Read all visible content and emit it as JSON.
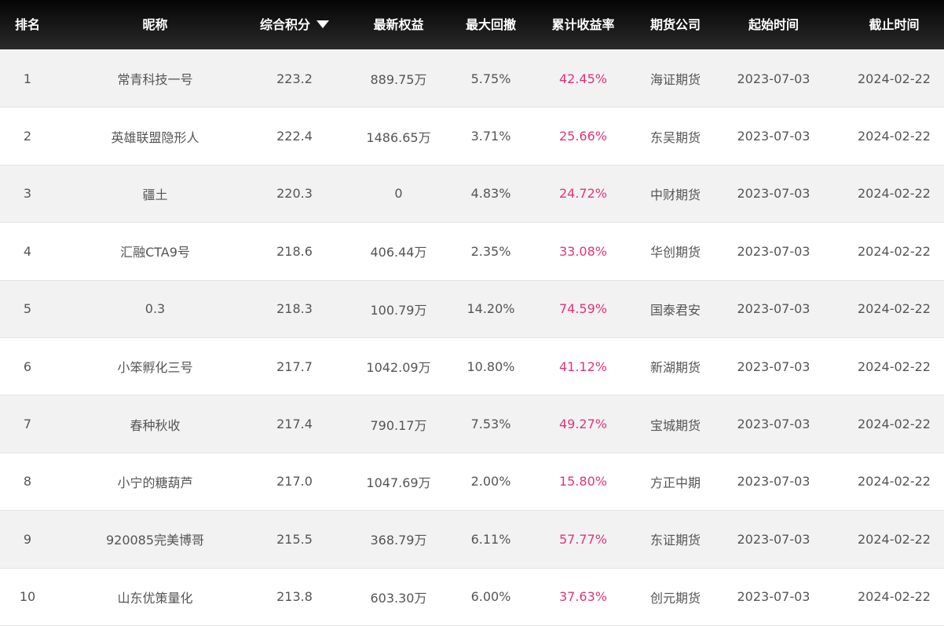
{
  "colors": {
    "header_bg": "#1a1a1a",
    "header_text": "#ffffff",
    "row_alt_bg": "#f2f2f2",
    "text": "#555555",
    "return_rate": "#e0357a"
  },
  "header": {
    "rank": "排名",
    "nickname": "昵称",
    "score": "综合积分",
    "score_sort_icon": "caret-down-icon",
    "equity": "最新权益",
    "drawdown": "最大回撤",
    "return_rate": "累计收益率",
    "broker": "期货公司",
    "start": "起始时间",
    "end": "截止时间"
  },
  "rows": [
    {
      "rank": "1",
      "nickname": "常青科技一号",
      "score": "223.2",
      "equity": "889.75万",
      "drawdown": "5.75%",
      "return_rate": "42.45%",
      "broker": "海证期货",
      "start": "2023-07-03",
      "end": "2024-02-22"
    },
    {
      "rank": "2",
      "nickname": "英雄联盟隐形人",
      "score": "222.4",
      "equity": "1486.65万",
      "drawdown": "3.71%",
      "return_rate": "25.66%",
      "broker": "东吴期货",
      "start": "2023-07-03",
      "end": "2024-02-22"
    },
    {
      "rank": "3",
      "nickname": "疆土",
      "score": "220.3",
      "equity": "0",
      "drawdown": "4.83%",
      "return_rate": "24.72%",
      "broker": "中财期货",
      "start": "2023-07-03",
      "end": "2024-02-22"
    },
    {
      "rank": "4",
      "nickname": "汇融CTA9号",
      "score": "218.6",
      "equity": "406.44万",
      "drawdown": "2.35%",
      "return_rate": "33.08%",
      "broker": "华创期货",
      "start": "2023-07-03",
      "end": "2024-02-22"
    },
    {
      "rank": "5",
      "nickname": "0.3",
      "score": "218.3",
      "equity": "100.79万",
      "drawdown": "14.20%",
      "return_rate": "74.59%",
      "broker": "国泰君安",
      "start": "2023-07-03",
      "end": "2024-02-22"
    },
    {
      "rank": "6",
      "nickname": "小笨孵化三号",
      "score": "217.7",
      "equity": "1042.09万",
      "drawdown": "10.80%",
      "return_rate": "41.12%",
      "broker": "新湖期货",
      "start": "2023-07-03",
      "end": "2024-02-22"
    },
    {
      "rank": "7",
      "nickname": "春种秋收",
      "score": "217.4",
      "equity": "790.17万",
      "drawdown": "7.53%",
      "return_rate": "49.27%",
      "broker": "宝城期货",
      "start": "2023-07-03",
      "end": "2024-02-22"
    },
    {
      "rank": "8",
      "nickname": "小宁的糖葫芦",
      "score": "217.0",
      "equity": "1047.69万",
      "drawdown": "2.00%",
      "return_rate": "15.80%",
      "broker": "方正中期",
      "start": "2023-07-03",
      "end": "2024-02-22"
    },
    {
      "rank": "9",
      "nickname": "920085完美博哥",
      "score": "215.5",
      "equity": "368.79万",
      "drawdown": "6.11%",
      "return_rate": "57.77%",
      "broker": "东证期货",
      "start": "2023-07-03",
      "end": "2024-02-22"
    },
    {
      "rank": "10",
      "nickname": "山东优策量化",
      "score": "213.8",
      "equity": "603.30万",
      "drawdown": "6.00%",
      "return_rate": "37.63%",
      "broker": "创元期货",
      "start": "2023-07-03",
      "end": "2024-02-22"
    }
  ]
}
